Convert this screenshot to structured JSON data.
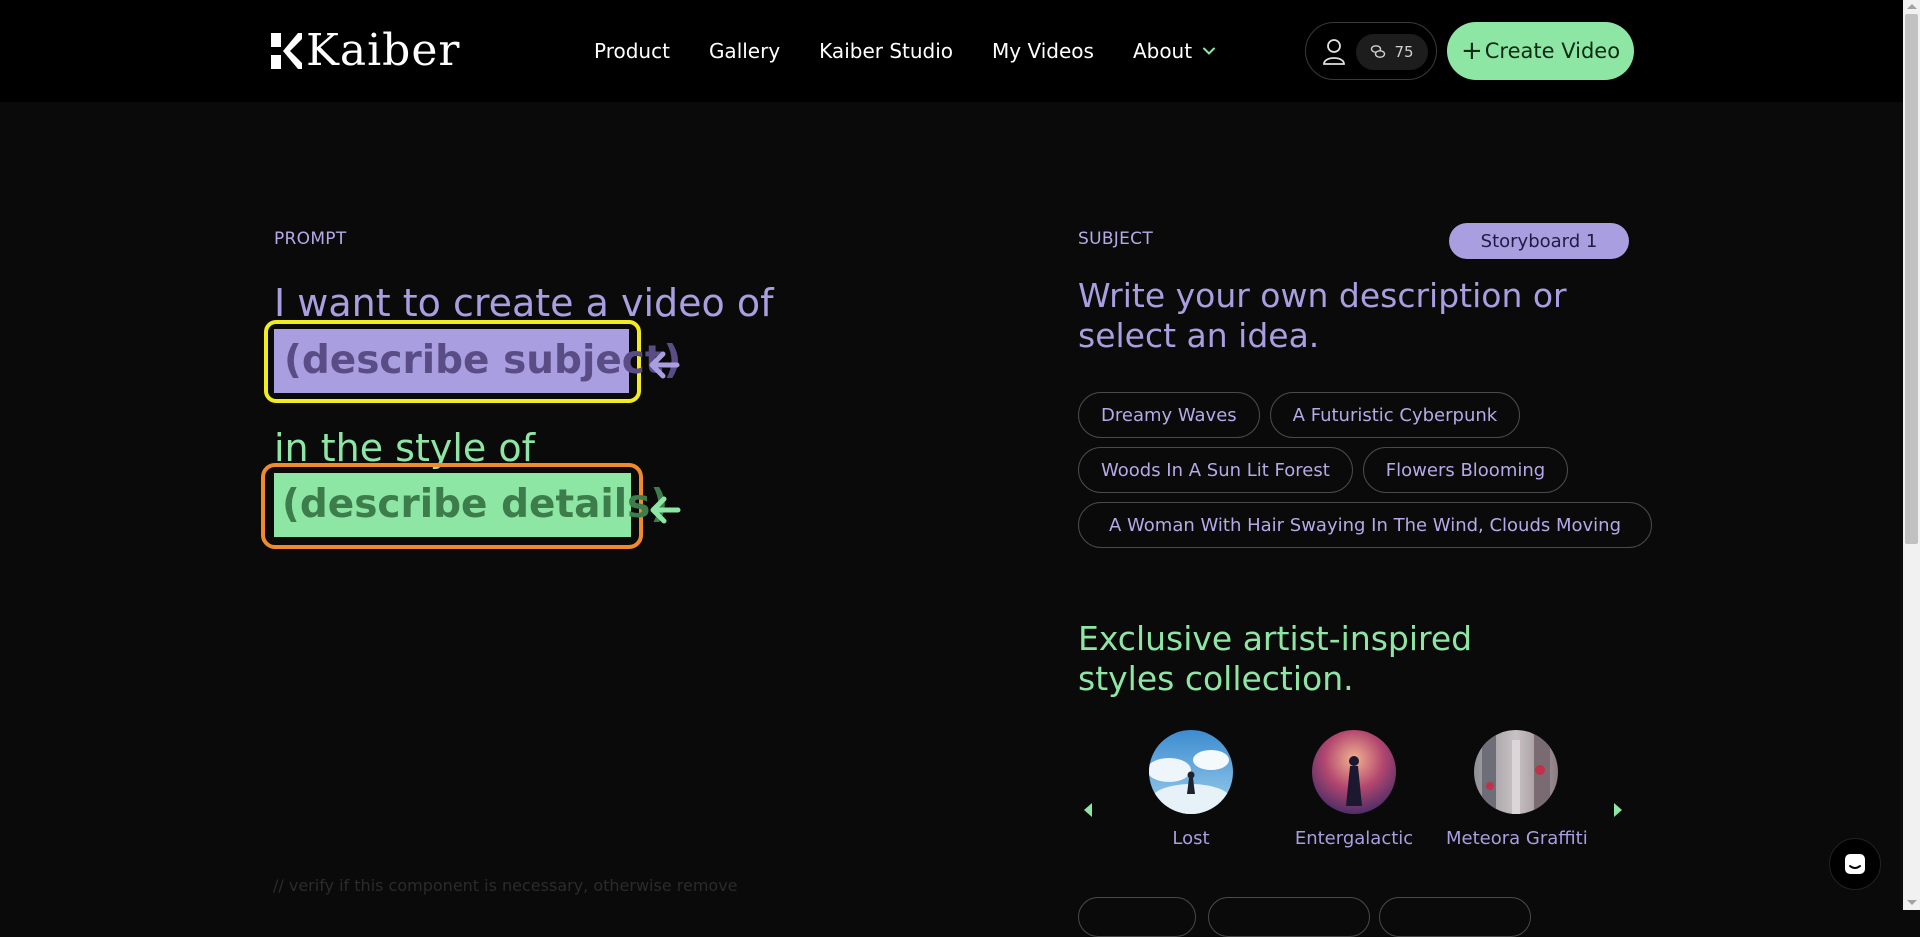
{
  "header": {
    "logo_text": "Kaiber",
    "nav": [
      "Product",
      "Gallery",
      "Kaiber Studio",
      "My Videos",
      "About"
    ],
    "credits": "75",
    "create_button": "Create Video"
  },
  "prompt": {
    "label": "PROMPT",
    "line1": "I want to create a video of",
    "subject_placeholder": "(describe subject)",
    "line2": "in the style of",
    "details_placeholder": "(describe details)",
    "dev_note": "// verify if this component is necessary, otherwise remove"
  },
  "subject": {
    "label": "SUBJECT",
    "storyboard": "Storyboard 1",
    "heading": "Write your own description or select an idea.",
    "ideas": [
      [
        "Dreamy Waves",
        "A Futuristic Cyberpunk"
      ],
      [
        "Woods In A Sun Lit Forest",
        "Flowers Blooming"
      ],
      [
        "A Woman With Hair Swaying In The Wind, Clouds Moving"
      ]
    ]
  },
  "styles": {
    "heading": "Exclusive artist-inspired styles collection.",
    "items": [
      {
        "name": "Lost"
      },
      {
        "name": "Entergalactic"
      },
      {
        "name": "Meteora Graffiti"
      }
    ]
  },
  "colors": {
    "accent_purple": "#a99ee0",
    "accent_green": "#8ee6a4",
    "highlight_yellow": "#f2ec1f",
    "highlight_orange": "#f08a2a"
  },
  "icons": [
    "kaiber-logo-icon",
    "chevron-down-icon",
    "user-icon",
    "credits-icon",
    "plus-icon",
    "arrow-left-icon",
    "carousel-prev-icon",
    "carousel-next-icon",
    "chat-icon"
  ]
}
